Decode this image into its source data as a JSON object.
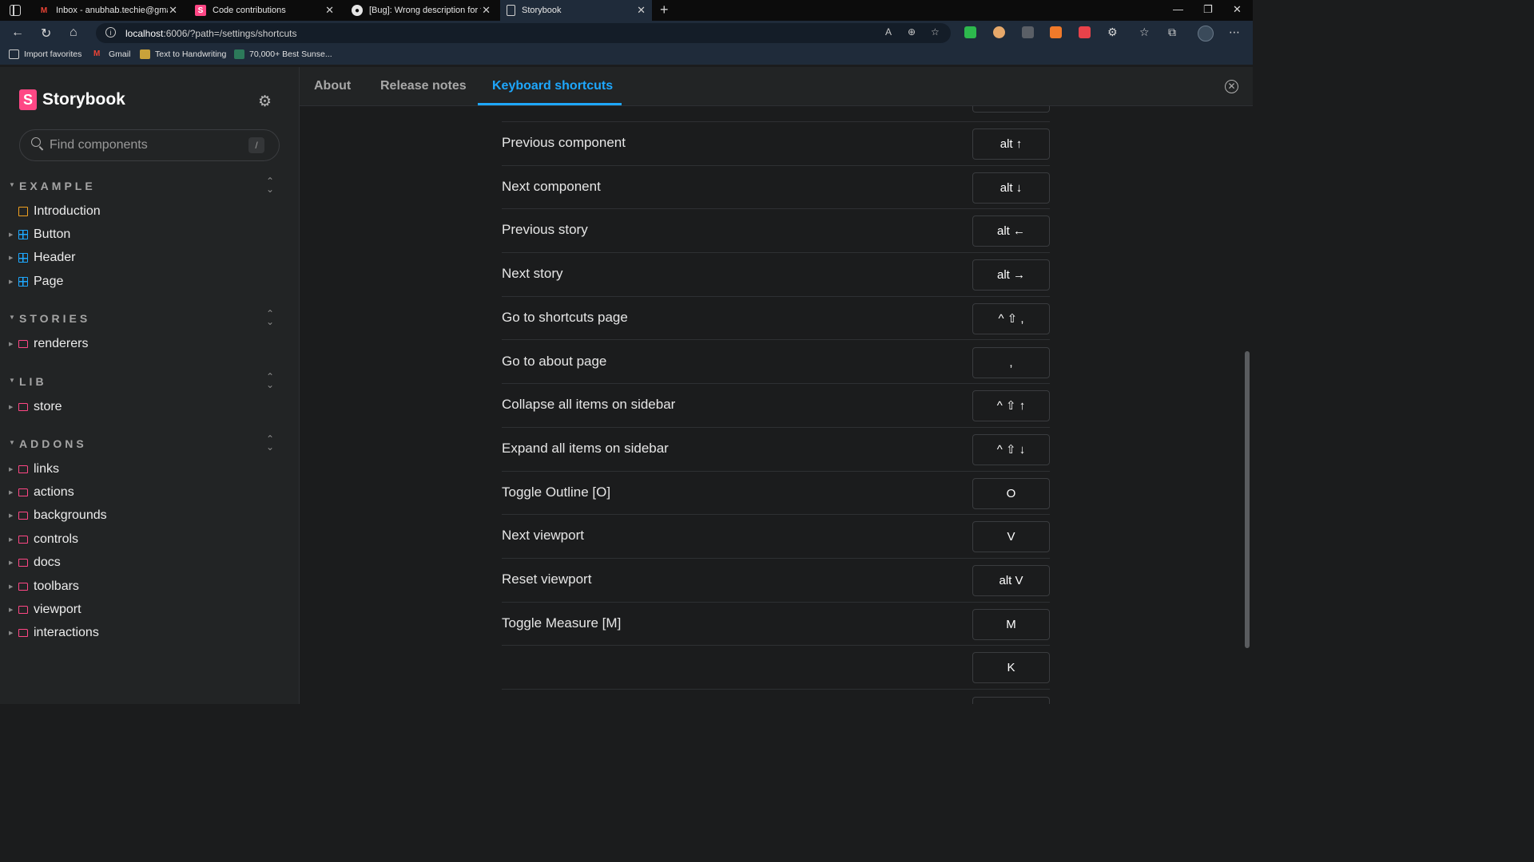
{
  "browser": {
    "tabs": [
      {
        "title": "Inbox - anubhab.techie@gmail.c",
        "favicon": "gmail-icon",
        "active": false
      },
      {
        "title": "Code contributions",
        "favicon": "storybook-icon",
        "active": false
      },
      {
        "title": "[Bug]: Wrong description for tog",
        "favicon": "github-icon",
        "active": false
      },
      {
        "title": "Storybook",
        "favicon": "page-icon",
        "active": true
      }
    ],
    "address": {
      "host": "localhost",
      "path": ":6006/?path=/settings/shortcuts"
    },
    "bookmarks": [
      "Import favorites",
      "Gmail",
      "Text to Handwriting",
      "70,000+ Best Sunse..."
    ]
  },
  "sidebar": {
    "brand": "Storybook",
    "search_placeholder": "Find components",
    "search_shortcut": "/",
    "groups": [
      {
        "label": "EXAMPLE",
        "items": [
          {
            "label": "Introduction",
            "icon": "doc-icon"
          },
          {
            "label": "Button",
            "icon": "component-icon"
          },
          {
            "label": "Header",
            "icon": "component-icon"
          },
          {
            "label": "Page",
            "icon": "component-icon"
          }
        ]
      },
      {
        "label": "STORIES",
        "items": [
          {
            "label": "renderers",
            "icon": "folder-icon"
          }
        ]
      },
      {
        "label": "LIB",
        "items": [
          {
            "label": "store",
            "icon": "folder-icon"
          }
        ]
      },
      {
        "label": "ADDONS",
        "items": [
          {
            "label": "links",
            "icon": "folder-icon"
          },
          {
            "label": "actions",
            "icon": "folder-icon"
          },
          {
            "label": "backgrounds",
            "icon": "folder-icon"
          },
          {
            "label": "controls",
            "icon": "folder-icon"
          },
          {
            "label": "docs",
            "icon": "folder-icon"
          },
          {
            "label": "toolbars",
            "icon": "folder-icon"
          },
          {
            "label": "viewport",
            "icon": "folder-icon"
          },
          {
            "label": "interactions",
            "icon": "folder-icon"
          }
        ]
      }
    ]
  },
  "main": {
    "tabs": [
      "About",
      "Release notes",
      "Keyboard shortcuts"
    ],
    "active_tab": "Keyboard shortcuts",
    "shortcuts": [
      {
        "name": "Previous component",
        "key": "alt ↑"
      },
      {
        "name": "Next component",
        "key": "alt ↓"
      },
      {
        "name": "Previous story",
        "key": "alt ←"
      },
      {
        "name": "Next story",
        "key": "alt →"
      },
      {
        "name": "Go to shortcuts page",
        "key": "^ ⇧ ,"
      },
      {
        "name": "Go to about page",
        "key": ","
      },
      {
        "name": "Collapse all items on sidebar",
        "key": "^ ⇧ ↑"
      },
      {
        "name": "Expand all items on sidebar",
        "key": "^ ⇧ ↓"
      },
      {
        "name": "Toggle Outline [O]",
        "key": "O"
      },
      {
        "name": "Next viewport",
        "key": "V"
      },
      {
        "name": "Reset viewport",
        "key": "alt V"
      },
      {
        "name": "Toggle Measure [M]",
        "key": "M"
      },
      {
        "name": "",
        "key": "K"
      }
    ]
  },
  "colors": {
    "accent": "#1ea7fd",
    "brand": "#ff4785"
  }
}
